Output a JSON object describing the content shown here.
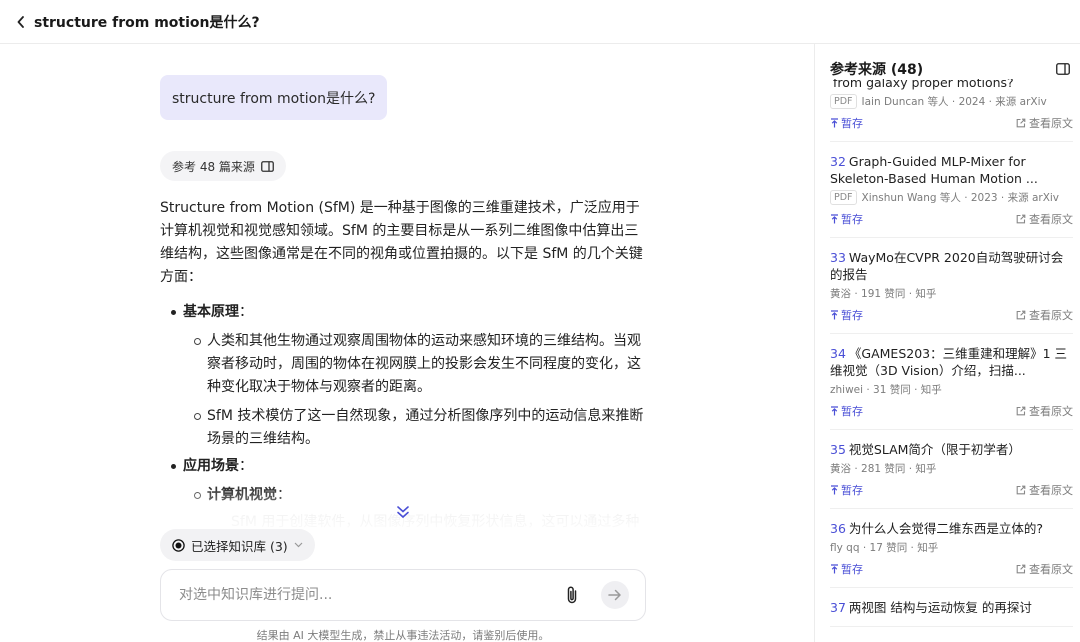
{
  "header": {
    "title": "structure from motion是什么?"
  },
  "chat": {
    "user_message": "structure from motion是什么?",
    "references_chip": "参考 48 篇来源",
    "answer": {
      "intro": "Structure from Motion (SfM) 是一种基于图像的三维重建技术，广泛应用于计算机视觉和视觉感知领域。SfM 的主要目标是从一系列二维图像中估算出三维结构，这些图像通常是在不同的视角或位置拍摄的。以下是 SfM 的几个关键方面：",
      "section1": {
        "heading": "基本原理",
        "colon": "：",
        "items": [
          "人类和其他生物通过观察周围物体的运动来感知环境的三维结构。当观察者移动时，周围的物体在视网膜上的投影会发生不同程度的变化，这种变化取决于物体与观察者的距离。",
          "SfM 技术模仿了这一自然现象，通过分析图像序列中的运动信息来推断场景的三维结构。"
        ]
      },
      "section2": {
        "heading": "应用场景",
        "colon": "：",
        "sub_heading": "计算机视觉",
        "faded_line": "SfM 用于创建软件，从图像序列中恢复形状信息，这可以通过多种"
      }
    }
  },
  "composer": {
    "kb_chip": "已选择知识库 (3)",
    "placeholder": "对选中知识库进行提问...",
    "disclaimer": "结果由 AI 大模型生成，禁止从事违法活动，请鉴别后使用。"
  },
  "sidebar": {
    "title": "参考来源 (48)",
    "sources": [
      {
        "num": "",
        "title": "from galaxy proper motions?",
        "badge": "PDF",
        "meta": "Iain Duncan 等人 · 2024 · 来源 arXiv",
        "save": "暂存",
        "view": "查看原文"
      },
      {
        "num": "32",
        "title": "Graph-Guided MLP-Mixer for Skeleton-Based Human Motion ...",
        "badge": "PDF",
        "meta": "Xinshun Wang 等人 · 2023 · 来源 arXiv",
        "save": "暂存",
        "view": "查看原文"
      },
      {
        "num": "33",
        "title": "WayMo在CVPR 2020自动驾驶研讨会的报告",
        "badge": "",
        "meta": "黄浴 · 191 赞同 · 知乎",
        "save": "暂存",
        "view": "查看原文"
      },
      {
        "num": "34",
        "title": "《GAMES203：三维重建和理解》1 三维视觉（3D Vision）介绍，扫描...",
        "badge": "",
        "meta": "zhiwei · 31 赞同 · 知乎",
        "save": "暂存",
        "view": "查看原文"
      },
      {
        "num": "35",
        "title": "视觉SLAM简介（限于初学者）",
        "badge": "",
        "meta": "黄浴 · 281 赞同 · 知乎",
        "save": "暂存",
        "view": "查看原文"
      },
      {
        "num": "36",
        "title": "为什么人会觉得二维东西是立体的?",
        "badge": "",
        "meta": "fly qq · 17 赞同 · 知乎",
        "save": "暂存",
        "view": "查看原文"
      },
      {
        "num": "37",
        "title": "两视图 结构与运动恢复 的再探讨",
        "badge": "",
        "meta": "",
        "save": "",
        "view": ""
      }
    ]
  }
}
